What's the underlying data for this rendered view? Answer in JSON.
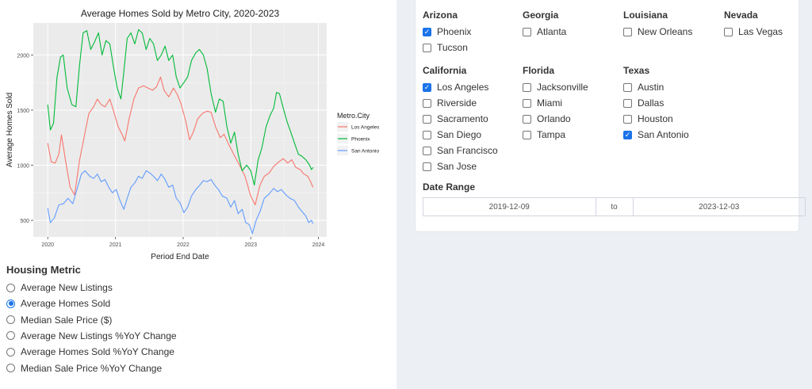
{
  "chart_data": {
    "type": "line",
    "title": "Average Homes Sold by Metro City, 2020-2023",
    "xlabel": "Period End Date",
    "ylabel": "Average Homes Sold",
    "x_ticks": [
      "2020",
      "2021",
      "2022",
      "2023",
      "2024"
    ],
    "y_ticks": [
      500,
      1000,
      1500,
      2000
    ],
    "xlim": [
      "2019-10-15",
      "2024-02-15"
    ],
    "ylim": [
      350,
      2290
    ],
    "legend_title": "Metro.City",
    "legend_placement": "right",
    "grid": true,
    "series": [
      {
        "name": "Los Angeles",
        "color": "#F8766D",
        "points": [
          [
            "2020-01-01",
            1200
          ],
          [
            "2020-01-20",
            1030
          ],
          [
            "2020-02-10",
            1020
          ],
          [
            "2020-03-01",
            1100
          ],
          [
            "2020-03-15",
            1275
          ],
          [
            "2020-04-10",
            1000
          ],
          [
            "2020-05-01",
            800
          ],
          [
            "2020-05-25",
            730
          ],
          [
            "2020-06-20",
            1040
          ],
          [
            "2020-07-15",
            1250
          ],
          [
            "2020-08-10",
            1470
          ],
          [
            "2020-09-05",
            1530
          ],
          [
            "2020-09-25",
            1600
          ],
          [
            "2020-10-15",
            1550
          ],
          [
            "2020-11-05",
            1530
          ],
          [
            "2020-12-01",
            1600
          ],
          [
            "2020-12-20",
            1500
          ],
          [
            "2021-01-15",
            1350
          ],
          [
            "2021-02-05",
            1280
          ],
          [
            "2021-02-20",
            1220
          ],
          [
            "2021-03-15",
            1420
          ],
          [
            "2021-04-10",
            1600
          ],
          [
            "2021-05-05",
            1700
          ],
          [
            "2021-06-01",
            1720
          ],
          [
            "2021-06-25",
            1700
          ],
          [
            "2021-07-20",
            1680
          ],
          [
            "2021-08-10",
            1710
          ],
          [
            "2021-09-01",
            1800
          ],
          [
            "2021-09-20",
            1680
          ],
          [
            "2021-10-15",
            1620
          ],
          [
            "2021-11-10",
            1700
          ],
          [
            "2021-12-01",
            1640
          ],
          [
            "2021-12-20",
            1560
          ],
          [
            "2022-01-15",
            1400
          ],
          [
            "2022-02-05",
            1230
          ],
          [
            "2022-02-25",
            1300
          ],
          [
            "2022-03-20",
            1420
          ],
          [
            "2022-04-15",
            1470
          ],
          [
            "2022-05-10",
            1490
          ],
          [
            "2022-06-01",
            1480
          ],
          [
            "2022-06-25",
            1350
          ],
          [
            "2022-07-20",
            1250
          ],
          [
            "2022-08-10",
            1280
          ],
          [
            "2022-09-01",
            1200
          ],
          [
            "2022-10-01",
            1100
          ],
          [
            "2022-11-01",
            1000
          ],
          [
            "2022-12-01",
            900
          ],
          [
            "2023-01-01",
            720
          ],
          [
            "2023-01-25",
            640
          ],
          [
            "2023-02-20",
            820
          ],
          [
            "2023-03-15",
            900
          ],
          [
            "2023-04-10",
            930
          ],
          [
            "2023-05-05",
            990
          ],
          [
            "2023-06-01",
            1030
          ],
          [
            "2023-06-25",
            1060
          ],
          [
            "2023-07-20",
            1020
          ],
          [
            "2023-08-10",
            1050
          ],
          [
            "2023-09-01",
            980
          ],
          [
            "2023-09-25",
            960
          ],
          [
            "2023-10-15",
            920
          ],
          [
            "2023-11-05",
            900
          ],
          [
            "2023-11-20",
            850
          ],
          [
            "2023-12-03",
            800
          ]
        ]
      },
      {
        "name": "Phoenix",
        "color": "#00BA38",
        "points": [
          [
            "2020-01-01",
            1550
          ],
          [
            "2020-01-15",
            1320
          ],
          [
            "2020-02-01",
            1380
          ],
          [
            "2020-02-20",
            1800
          ],
          [
            "2020-03-10",
            1980
          ],
          [
            "2020-03-25",
            2000
          ],
          [
            "2020-04-15",
            1700
          ],
          [
            "2020-05-10",
            1550
          ],
          [
            "2020-06-01",
            1530
          ],
          [
            "2020-06-20",
            1900
          ],
          [
            "2020-07-10",
            2200
          ],
          [
            "2020-07-30",
            2220
          ],
          [
            "2020-08-20",
            2050
          ],
          [
            "2020-09-10",
            2120
          ],
          [
            "2020-10-01",
            2200
          ],
          [
            "2020-10-20",
            2000
          ],
          [
            "2020-11-10",
            2130
          ],
          [
            "2020-12-01",
            2100
          ],
          [
            "2020-12-20",
            1900
          ],
          [
            "2021-01-10",
            1700
          ],
          [
            "2021-01-30",
            1600
          ],
          [
            "2021-02-15",
            1850
          ],
          [
            "2021-03-05",
            2150
          ],
          [
            "2021-03-25",
            2200
          ],
          [
            "2021-04-15",
            2100
          ],
          [
            "2021-05-05",
            2230
          ],
          [
            "2021-05-25",
            2200
          ],
          [
            "2021-06-15",
            2050
          ],
          [
            "2021-07-05",
            2150
          ],
          [
            "2021-07-25",
            2100
          ],
          [
            "2021-08-15",
            1950
          ],
          [
            "2021-09-05",
            2000
          ],
          [
            "2021-09-25",
            2080
          ],
          [
            "2021-10-15",
            1950
          ],
          [
            "2021-11-05",
            2000
          ],
          [
            "2021-11-25",
            1800
          ],
          [
            "2021-12-15",
            1700
          ],
          [
            "2022-01-05",
            1750
          ],
          [
            "2022-01-25",
            1800
          ],
          [
            "2022-02-15",
            1950
          ],
          [
            "2022-03-10",
            2020
          ],
          [
            "2022-03-30",
            2050
          ],
          [
            "2022-04-20",
            2000
          ],
          [
            "2022-05-10",
            1880
          ],
          [
            "2022-06-01",
            1650
          ],
          [
            "2022-06-25",
            1480
          ],
          [
            "2022-07-15",
            1600
          ],
          [
            "2022-08-05",
            1580
          ],
          [
            "2022-08-25",
            1350
          ],
          [
            "2022-09-15",
            1200
          ],
          [
            "2022-10-05",
            1300
          ],
          [
            "2022-10-25",
            1100
          ],
          [
            "2022-11-15",
            950
          ],
          [
            "2022-12-10",
            1000
          ],
          [
            "2023-01-01",
            950
          ],
          [
            "2023-01-20",
            820
          ],
          [
            "2023-02-10",
            1050
          ],
          [
            "2023-03-01",
            1150
          ],
          [
            "2023-03-25",
            1350
          ],
          [
            "2023-04-15",
            1450
          ],
          [
            "2023-05-05",
            1520
          ],
          [
            "2023-05-20",
            1660
          ],
          [
            "2023-06-05",
            1650
          ],
          [
            "2023-06-25",
            1520
          ],
          [
            "2023-07-15",
            1400
          ],
          [
            "2023-08-05",
            1300
          ],
          [
            "2023-08-25",
            1200
          ],
          [
            "2023-09-15",
            1100
          ],
          [
            "2023-10-05",
            1080
          ],
          [
            "2023-10-25",
            1050
          ],
          [
            "2023-11-15",
            1000
          ],
          [
            "2023-11-25",
            960
          ],
          [
            "2023-12-03",
            980
          ]
        ]
      },
      {
        "name": "San Antonio",
        "color": "#619CFF",
        "points": [
          [
            "2020-01-01",
            610
          ],
          [
            "2020-01-15",
            480
          ],
          [
            "2020-02-05",
            520
          ],
          [
            "2020-03-01",
            640
          ],
          [
            "2020-03-25",
            650
          ],
          [
            "2020-04-20",
            700
          ],
          [
            "2020-05-15",
            650
          ],
          [
            "2020-06-10",
            800
          ],
          [
            "2020-07-01",
            920
          ],
          [
            "2020-07-20",
            950
          ],
          [
            "2020-08-15",
            900
          ],
          [
            "2020-09-05",
            880
          ],
          [
            "2020-09-25",
            920
          ],
          [
            "2020-10-15",
            850
          ],
          [
            "2020-11-05",
            870
          ],
          [
            "2020-11-25",
            800
          ],
          [
            "2020-12-15",
            750
          ],
          [
            "2021-01-05",
            780
          ],
          [
            "2021-01-25",
            680
          ],
          [
            "2021-02-15",
            600
          ],
          [
            "2021-03-05",
            700
          ],
          [
            "2021-03-25",
            800
          ],
          [
            "2021-04-15",
            840
          ],
          [
            "2021-05-05",
            900
          ],
          [
            "2021-05-25",
            880
          ],
          [
            "2021-06-15",
            950
          ],
          [
            "2021-07-05",
            930
          ],
          [
            "2021-07-25",
            900
          ],
          [
            "2021-08-15",
            860
          ],
          [
            "2021-09-05",
            920
          ],
          [
            "2021-09-25",
            870
          ],
          [
            "2021-10-15",
            800
          ],
          [
            "2021-11-05",
            820
          ],
          [
            "2021-11-25",
            700
          ],
          [
            "2021-12-15",
            660
          ],
          [
            "2022-01-05",
            570
          ],
          [
            "2022-01-25",
            620
          ],
          [
            "2022-02-15",
            720
          ],
          [
            "2022-03-10",
            780
          ],
          [
            "2022-04-01",
            820
          ],
          [
            "2022-04-20",
            860
          ],
          [
            "2022-05-10",
            850
          ],
          [
            "2022-06-01",
            870
          ],
          [
            "2022-06-20",
            820
          ],
          [
            "2022-07-10",
            780
          ],
          [
            "2022-08-01",
            720
          ],
          [
            "2022-08-25",
            700
          ],
          [
            "2022-09-15",
            620
          ],
          [
            "2022-10-05",
            680
          ],
          [
            "2022-10-25",
            560
          ],
          [
            "2022-11-15",
            600
          ],
          [
            "2022-12-05",
            480
          ],
          [
            "2022-12-25",
            460
          ],
          [
            "2023-01-10",
            380
          ],
          [
            "2023-01-30",
            500
          ],
          [
            "2023-02-20",
            580
          ],
          [
            "2023-03-15",
            700
          ],
          [
            "2023-04-10",
            740
          ],
          [
            "2023-05-05",
            790
          ],
          [
            "2023-05-25",
            760
          ],
          [
            "2023-06-15",
            780
          ],
          [
            "2023-07-10",
            730
          ],
          [
            "2023-08-01",
            700
          ],
          [
            "2023-08-25",
            680
          ],
          [
            "2023-09-15",
            620
          ],
          [
            "2023-10-05",
            580
          ],
          [
            "2023-10-25",
            540
          ],
          [
            "2023-11-10",
            480
          ],
          [
            "2023-11-25",
            500
          ],
          [
            "2023-12-03",
            470
          ]
        ]
      }
    ]
  },
  "housing_metric": {
    "title": "Housing Metric",
    "options": [
      {
        "label": "Average New Listings",
        "selected": false
      },
      {
        "label": "Average Homes Sold",
        "selected": true
      },
      {
        "label": "Median Sale Price ($)",
        "selected": false
      },
      {
        "label": "Average New Listings %YoY Change",
        "selected": false
      },
      {
        "label": "Average Homes Sold %YoY Change",
        "selected": false
      },
      {
        "label": "Median Sale Price %YoY Change",
        "selected": false
      }
    ]
  },
  "states": [
    {
      "name": "Arizona",
      "cities": [
        {
          "label": "Phoenix",
          "checked": true
        },
        {
          "label": "Tucson",
          "checked": false
        }
      ]
    },
    {
      "name": "Georgia",
      "cities": [
        {
          "label": "Atlanta",
          "checked": false
        }
      ]
    },
    {
      "name": "Louisiana",
      "cities": [
        {
          "label": "New Orleans",
          "checked": false
        }
      ]
    },
    {
      "name": "Nevada",
      "cities": [
        {
          "label": "Las Vegas",
          "checked": false
        }
      ]
    },
    {
      "name": "California",
      "cities": [
        {
          "label": "Los Angeles",
          "checked": true
        },
        {
          "label": "Riverside",
          "checked": false
        },
        {
          "label": "Sacramento",
          "checked": false
        },
        {
          "label": "San Diego",
          "checked": false
        },
        {
          "label": "San Francisco",
          "checked": false
        },
        {
          "label": "San Jose",
          "checked": false
        }
      ]
    },
    {
      "name": "Florida",
      "cities": [
        {
          "label": "Jacksonville",
          "checked": false
        },
        {
          "label": "Miami",
          "checked": false
        },
        {
          "label": "Orlando",
          "checked": false
        },
        {
          "label": "Tampa",
          "checked": false
        }
      ]
    },
    {
      "name": "Texas",
      "cities": [
        {
          "label": "Austin",
          "checked": false
        },
        {
          "label": "Dallas",
          "checked": false
        },
        {
          "label": "Houston",
          "checked": false
        },
        {
          "label": "San Antonio",
          "checked": true
        }
      ]
    }
  ],
  "date_range": {
    "label": "Date Range",
    "start": "2019-12-09",
    "separator": "to",
    "end": "2023-12-03"
  },
  "colors": {
    "accent": "#1a73e8",
    "panel_background": "#ecf0f5",
    "plot_background": "#EBEBEB"
  }
}
